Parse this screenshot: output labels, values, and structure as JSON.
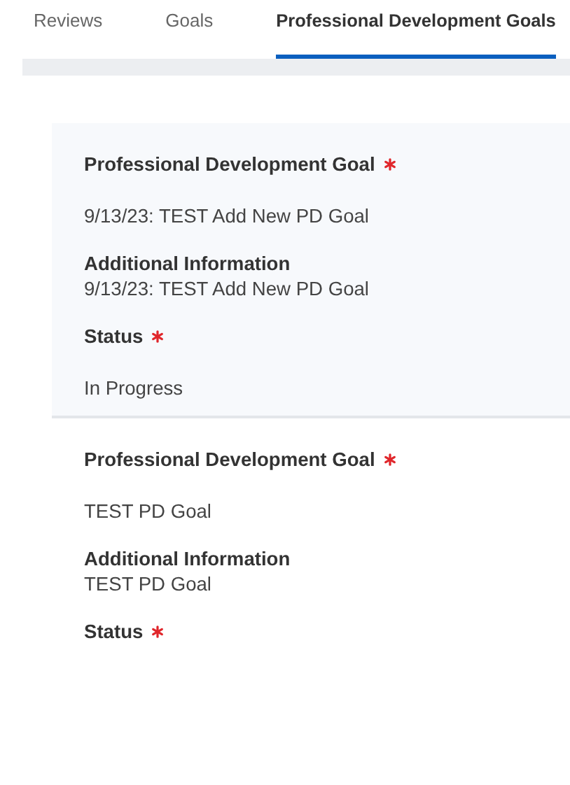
{
  "tabs": [
    {
      "label": "Reviews",
      "selected": false
    },
    {
      "label": "Goals",
      "selected": false
    },
    {
      "label": "Professional Development Goals",
      "selected": true
    }
  ],
  "goals": [
    {
      "highlighted": true,
      "fields": [
        {
          "label": "Professional Development Goal",
          "required": true,
          "value": "9/13/23: TEST Add New PD Goal"
        },
        {
          "label": "Additional Information",
          "required": false,
          "value": "9/13/23: TEST Add New PD Goal"
        },
        {
          "label": "Status",
          "required": true,
          "value": "In Progress"
        }
      ]
    },
    {
      "highlighted": false,
      "fields": [
        {
          "label": "Professional Development Goal",
          "required": true,
          "value": "TEST PD Goal"
        },
        {
          "label": "Additional Information",
          "required": false,
          "value": "TEST PD Goal"
        },
        {
          "label": "Status",
          "required": true
        }
      ]
    }
  ]
}
